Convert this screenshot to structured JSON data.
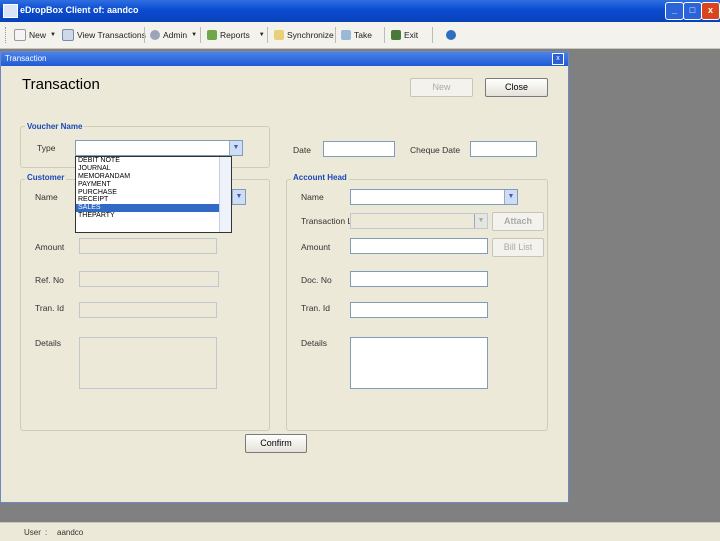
{
  "window": {
    "title": "eDropBox Client of: aandco",
    "minimize": "_",
    "maximize": "□",
    "close": "x"
  },
  "toolbar": {
    "new": "New",
    "view_transactions": "View Transactions",
    "admin": "Admin",
    "reports": "Reports",
    "synchronize": "Synchronize",
    "take": "Take",
    "exit": "Exit"
  },
  "child_window": {
    "title": "Transaction",
    "close": "x"
  },
  "form": {
    "heading": "Transaction",
    "new_button": "New",
    "close_button": "Close",
    "voucher_group": "Voucher Name",
    "type_label": "Type",
    "date_label": "Date",
    "cheque_date_label": "Cheque Date",
    "customer_group": "Customer",
    "name_label": "Name",
    "amount_label": "Amount",
    "ref_no_label": "Ref. No",
    "tran_id_label": "Tran. Id",
    "details_label": "Details",
    "account_group": "Account Head",
    "acc_name_label": "Name",
    "transaction_list_label": "Transaction List",
    "attach_button": "Attach",
    "acc_amount_label": "Amount",
    "bill_list_button": "Bill List",
    "doc_no_label": "Doc. No",
    "acc_tran_id_label": "Tran. Id",
    "acc_details_label": "Details",
    "confirm_button": "Confirm"
  },
  "type_dropdown": {
    "options": [
      "DEBIT NOTE",
      "JOURNAL",
      "MEMORANDAM",
      "PAYMENT",
      "PURCHASE",
      "RECEIPT",
      "SALES",
      "THEPARTY"
    ],
    "selected": "SALES"
  },
  "status": {
    "user_label": "User",
    "sep": ":",
    "user_value": "aandco"
  },
  "colors": {
    "titlebar": "#0a4bd1",
    "form_bg": "#ece9d8",
    "selection": "#316ac5",
    "group_label": "#1b48b8"
  }
}
